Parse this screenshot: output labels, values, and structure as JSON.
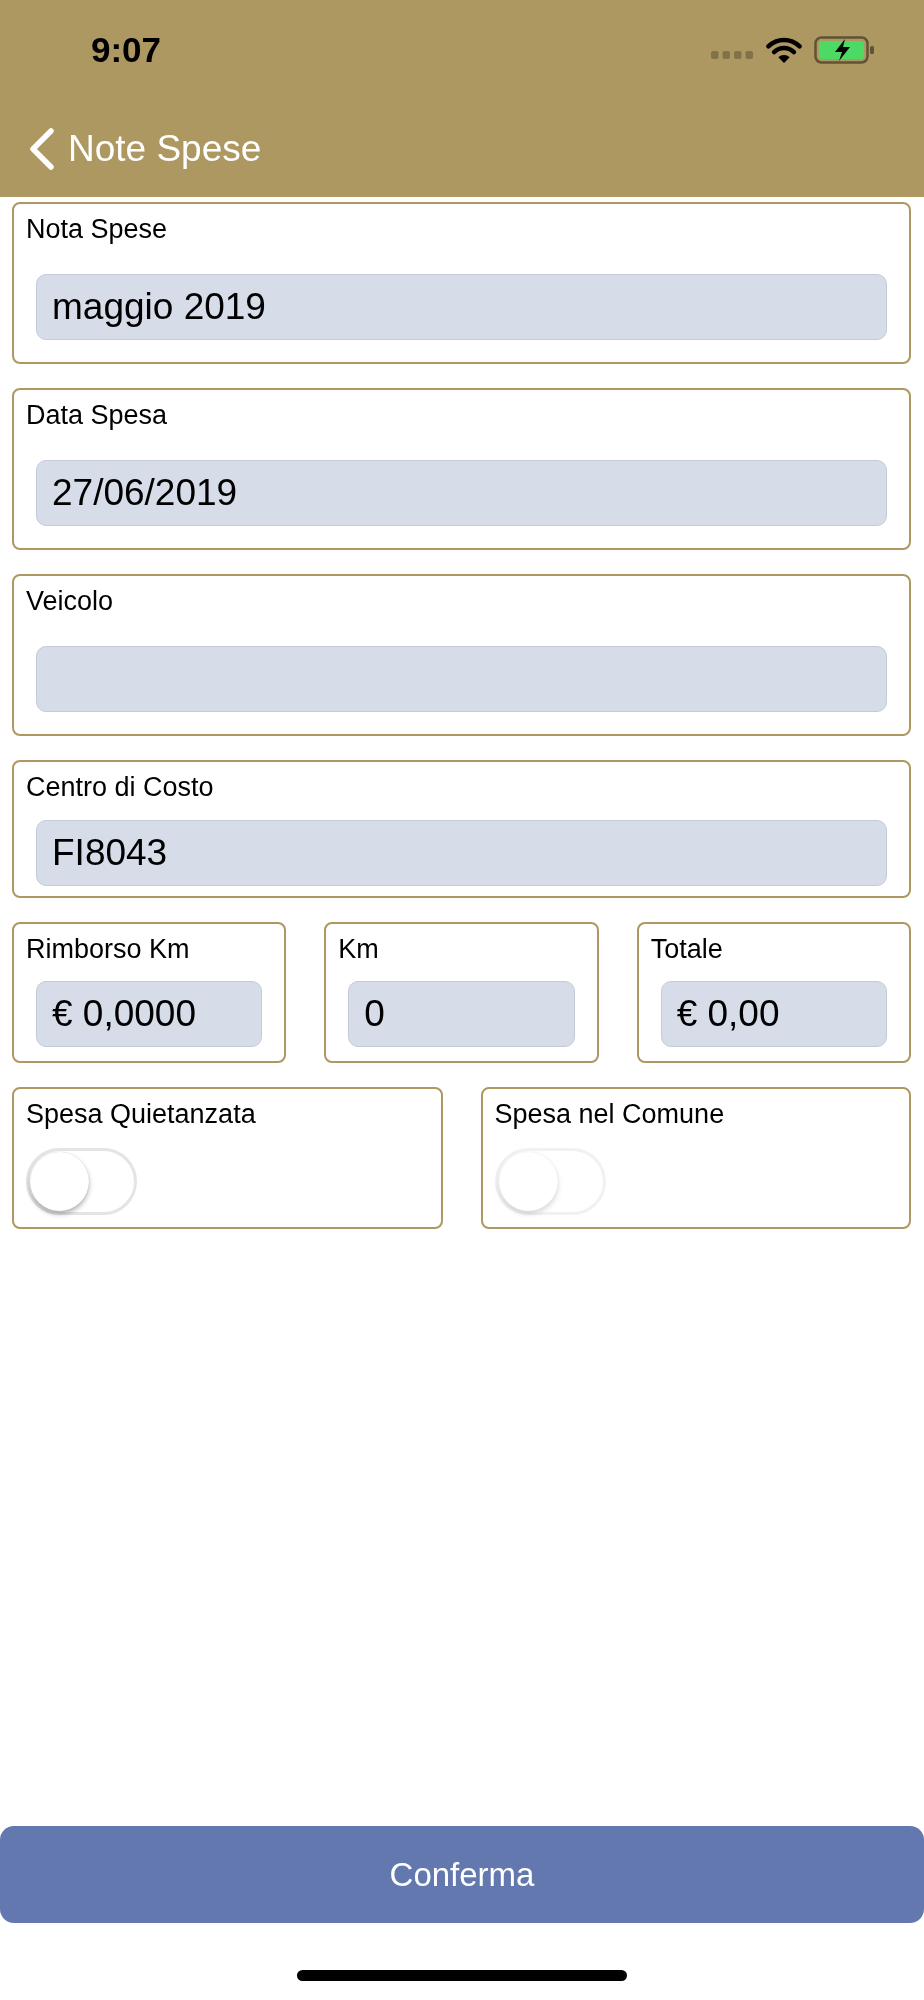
{
  "status_bar": {
    "time": "9:07"
  },
  "nav_bar": {
    "back_label": "Note Spese"
  },
  "fields": [
    {
      "label": "Nota Spese",
      "value": "maggio 2019"
    },
    {
      "label": "Data Spesa",
      "value": "27/06/2019"
    },
    {
      "label": "Veicolo"
    }
  ],
  "cost_center": {
    "label": "Centro di Costo",
    "value": "FI8043"
  },
  "amounts": [
    {
      "label": "Rimborso Km",
      "value": "€ 0,0000"
    },
    {
      "label": "Km",
      "value": "0"
    },
    {
      "label": "Totale",
      "value": "€ 0,00"
    }
  ],
  "switches": [
    {
      "label": "Spesa Quietanzata",
      "on": false,
      "disabled": false
    },
    {
      "label": "Spesa nel Comune",
      "on": false,
      "disabled": true
    }
  ],
  "confirm_button": {
    "label": "Conferma"
  }
}
